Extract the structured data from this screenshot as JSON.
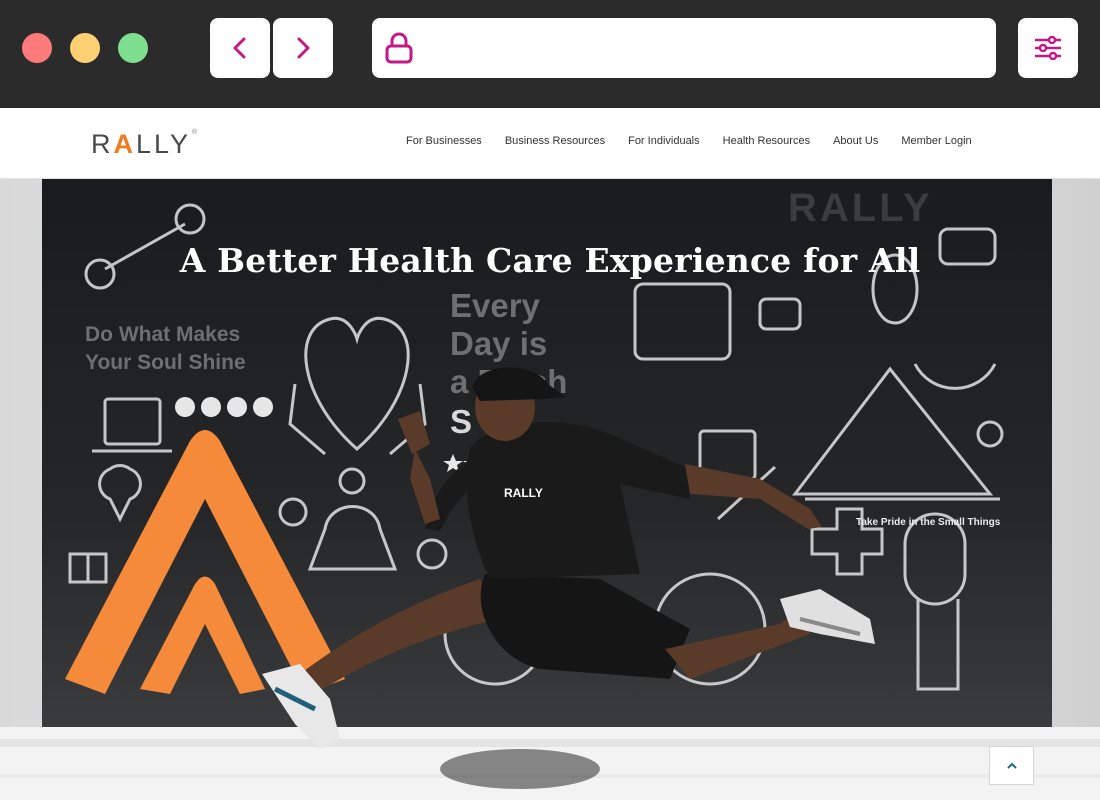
{
  "browser": {
    "window_controls": [
      "close",
      "minimize",
      "maximize"
    ],
    "back_icon": "chevron-left-icon",
    "forward_icon": "chevron-right-icon",
    "lock_icon": "lock-icon",
    "menu_icon": "sliders-icon",
    "url": "",
    "accent_color": "#c2188a"
  },
  "site": {
    "logo_text_pre": "R",
    "logo_text_a": "A",
    "logo_text_post": "LLY",
    "logo_reg": "®",
    "nav": [
      {
        "label": "For Businesses"
      },
      {
        "label": "Business Resources"
      },
      {
        "label": "For Individuals"
      },
      {
        "label": "Health Resources"
      },
      {
        "label": "About Us"
      },
      {
        "label": "Member Login"
      }
    ],
    "brand_orange": "#f07d1f"
  },
  "hero": {
    "title": "A Better Health Care Experience for All",
    "window_text_1": "Do What Makes",
    "window_text_2": "Your Soul Shine",
    "window_text_3": "Every",
    "window_text_4": "Day is",
    "window_text_5": "a Fresh",
    "window_text_6": "S",
    "window_text_7": "Take Pride in the Small Things",
    "window_text_8": "RALLY",
    "shirt_text": "RALLY",
    "scroll_top_icon": "chevron-up-icon"
  }
}
